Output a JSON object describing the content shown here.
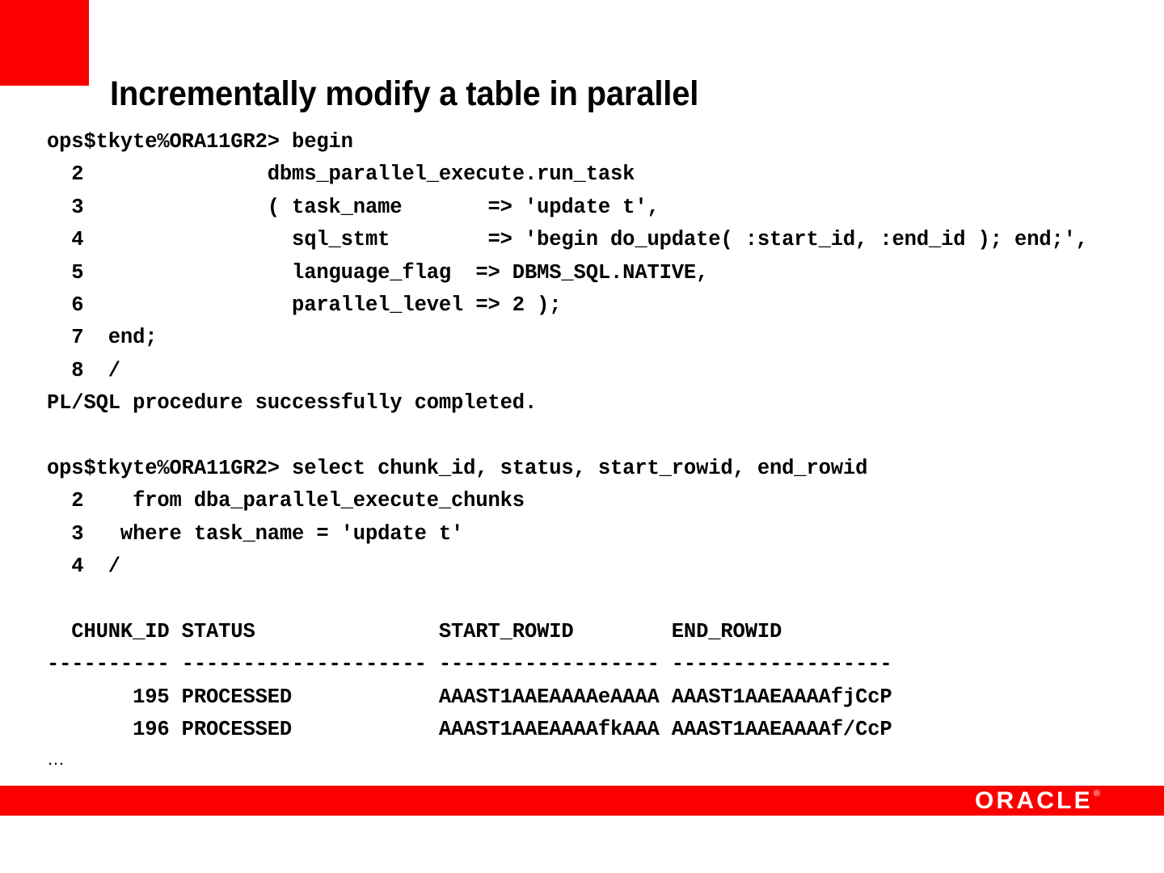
{
  "theme": {
    "accent_red": "#fc0000",
    "background": "#ffffff",
    "text": "#000000"
  },
  "slide": {
    "title": "Incrementally modify a table in parallel"
  },
  "console": {
    "lines": [
      "ops$tkyte%ORA11GR2> begin",
      "  2               dbms_parallel_execute.run_task",
      "  3               ( task_name       => 'update t',",
      "  4                 sql_stmt        => 'begin do_update( :start_id, :end_id ); end;',",
      "  5                 language_flag  => DBMS_SQL.NATIVE,",
      "  6                 parallel_level => 2 );",
      "  7  end;",
      "  8  /",
      "PL/SQL procedure successfully completed.",
      "",
      "ops$tkyte%ORA11GR2> select chunk_id, status, start_rowid, end_rowid",
      "  2    from dba_parallel_execute_chunks",
      "  3   where task_name = 'update t'",
      "  4  /",
      "",
      "  CHUNK_ID STATUS               START_ROWID        END_ROWID",
      "---------- -------------------- ------------------ ------------------",
      "       195 PROCESSED            AAAST1AAEAAAAeAAAA AAAST1AAEAAAAfjCcP",
      "       196 PROCESSED            AAAST1AAEAAAAfkAAA AAAST1AAEAAAAf/CcP"
    ],
    "truncation_marker": "…"
  },
  "result_table": {
    "columns": [
      "CHUNK_ID",
      "STATUS",
      "START_ROWID",
      "END_ROWID"
    ],
    "separator_widths": [
      10,
      20,
      18,
      18
    ],
    "rows": [
      {
        "CHUNK_ID": "195",
        "STATUS": "PROCESSED",
        "START_ROWID": "AAAST1AAEAAAAeAAAA",
        "END_ROWID": "AAAST1AAEAAAAfjCcP"
      },
      {
        "CHUNK_ID": "196",
        "STATUS": "PROCESSED",
        "START_ROWID": "AAAST1AAEAAAAfkAAA",
        "END_ROWID": "AAAST1AAEAAAAf/CcP"
      }
    ]
  },
  "footer": {
    "brand_wordmark": "ORACLE",
    "registered_mark": "®"
  }
}
